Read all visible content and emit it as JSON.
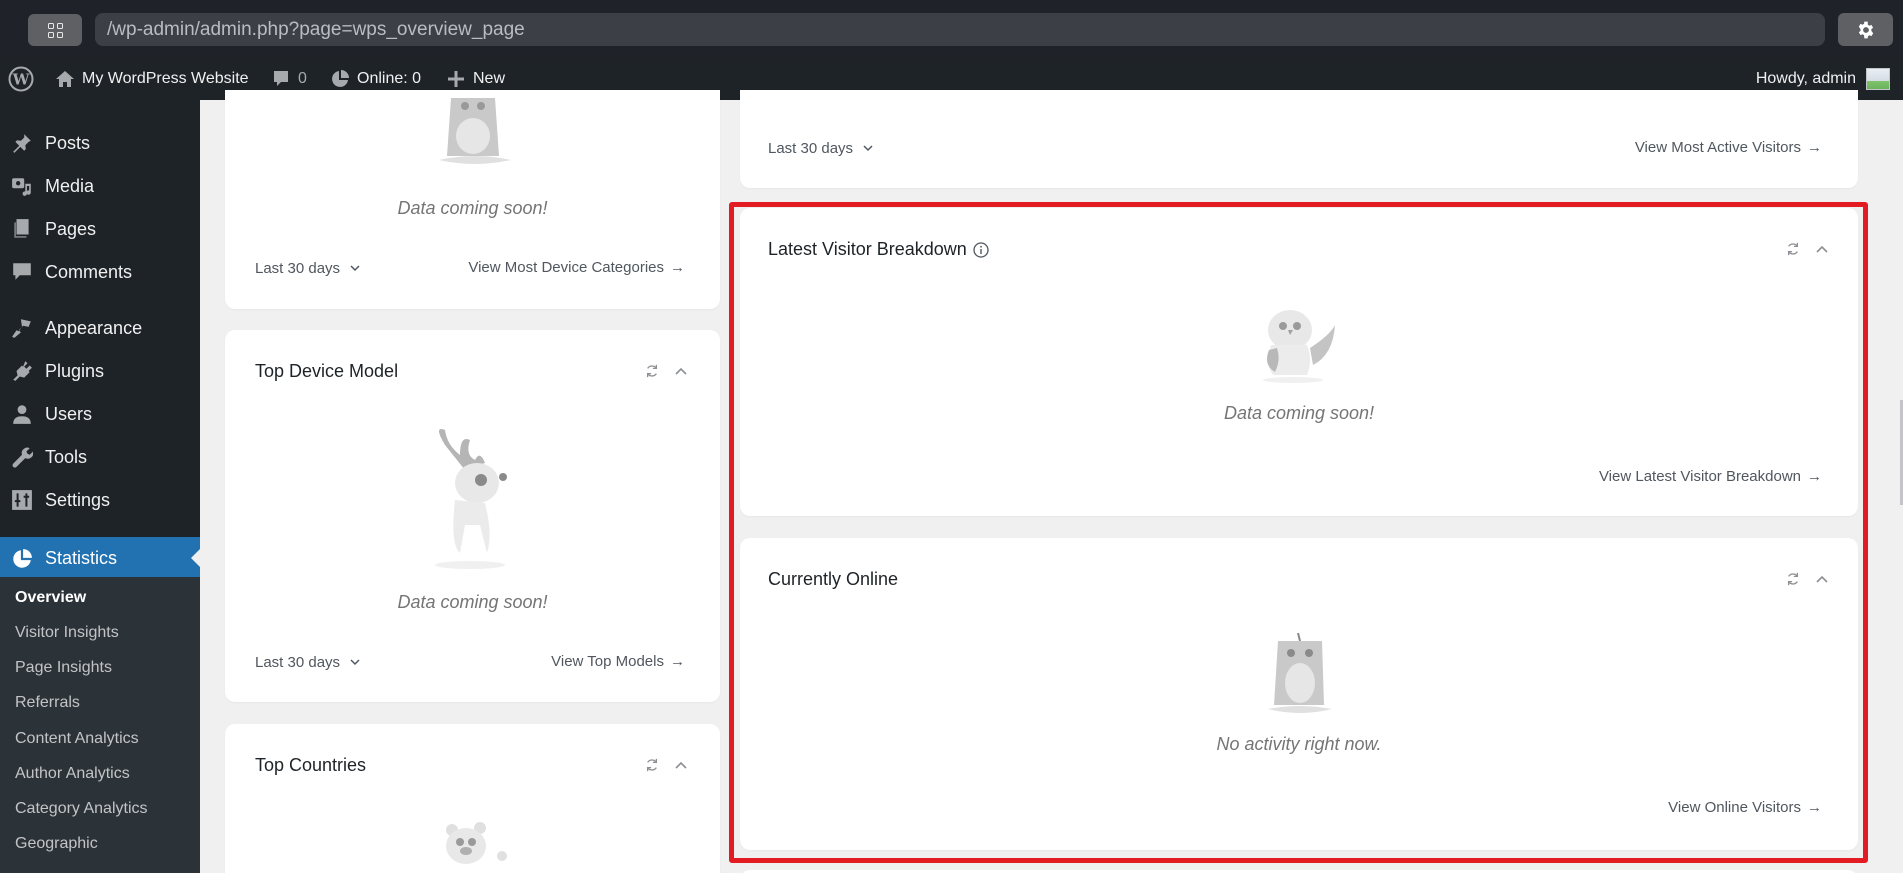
{
  "browser": {
    "url": "/wp-admin/admin.php?page=wps_overview_page",
    "apps_icon": "apps-grid-icon",
    "settings_icon": "gear-icon"
  },
  "adminbar": {
    "site_name": "My WordPress Website",
    "comments_count": "0",
    "online": "Online: 0",
    "new": "New",
    "howdy": "Howdy, admin"
  },
  "sidebar": {
    "items": [
      {
        "label": "Posts",
        "icon": "pin-icon"
      },
      {
        "label": "Media",
        "icon": "media-icon"
      },
      {
        "label": "Pages",
        "icon": "pages-icon"
      },
      {
        "label": "Comments",
        "icon": "comment-icon"
      },
      {
        "label": "Appearance",
        "icon": "brush-icon"
      },
      {
        "label": "Plugins",
        "icon": "plug-icon"
      },
      {
        "label": "Users",
        "icon": "user-icon"
      },
      {
        "label": "Tools",
        "icon": "wrench-icon"
      },
      {
        "label": "Settings",
        "icon": "sliders-icon"
      },
      {
        "label": "Statistics",
        "icon": "pie-chart-icon",
        "active": true
      }
    ],
    "submenu": [
      {
        "label": "Overview",
        "current": true
      },
      {
        "label": "Visitor Insights"
      },
      {
        "label": "Page Insights"
      },
      {
        "label": "Referrals"
      },
      {
        "label": "Content Analytics"
      },
      {
        "label": "Author Analytics"
      },
      {
        "label": "Category Analytics"
      },
      {
        "label": "Geographic"
      }
    ]
  },
  "widgets": {
    "device_categories": {
      "empty_text": "Data coming soon!",
      "filter": "Last 30 days",
      "link": "View Most Device Categories"
    },
    "top_device_model": {
      "title": "Top Device Model",
      "empty_text": "Data coming soon!",
      "filter": "Last 30 days",
      "link": "View Top Models"
    },
    "top_countries": {
      "title": "Top Countries"
    },
    "most_active_visitors": {
      "filter": "Last 30 days",
      "link": "View Most Active Visitors"
    },
    "latest_visitor_breakdown": {
      "title": "Latest Visitor Breakdown",
      "empty_text": "Data coming soon!",
      "link": "View Latest Visitor Breakdown"
    },
    "currently_online": {
      "title": "Currently Online",
      "empty_text": "No activity right now.",
      "link": "View Online Visitors"
    }
  },
  "colors": {
    "accent": "#2271b1",
    "highlight": "#e31b23",
    "adminbar": "#1d2327"
  }
}
